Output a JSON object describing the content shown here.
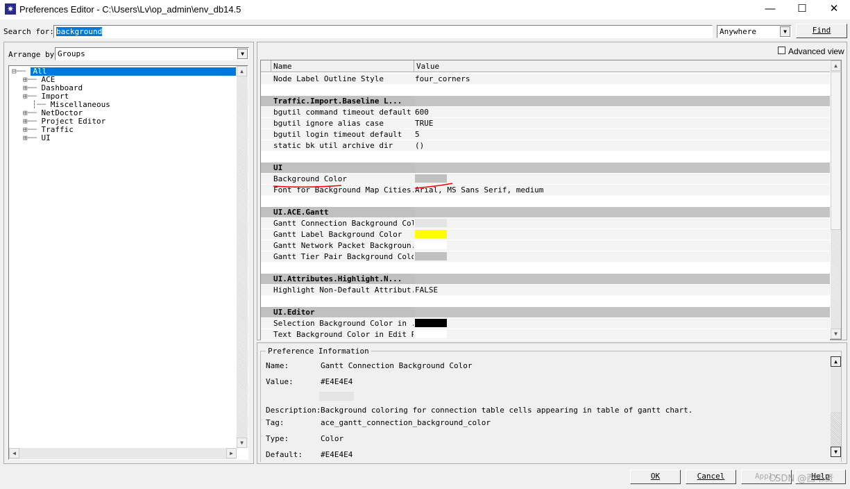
{
  "window": {
    "title": "Preferences Editor - C:\\Users\\Lv\\op_admin\\env_db14.5",
    "minimize": "—",
    "maximize": "☐",
    "close": "✕"
  },
  "search": {
    "label": "Search for:",
    "value": "background",
    "scope": "Anywhere",
    "find_label": "Find"
  },
  "left": {
    "arrange_label": "Arrange by",
    "arrange_value": "Groups",
    "tree": [
      {
        "label": "All",
        "selected": true
      },
      {
        "label": "ACE"
      },
      {
        "label": "Dashboard"
      },
      {
        "label": "Import"
      },
      {
        "label": "Miscellaneous",
        "leaf": true
      },
      {
        "label": "NetDoctor"
      },
      {
        "label": "Project Editor"
      },
      {
        "label": "Traffic"
      },
      {
        "label": "UI"
      }
    ]
  },
  "advanced_view": "Advanced view",
  "table": {
    "headers": [
      "Name",
      "Value"
    ],
    "rows": [
      {
        "name": "Node Label Outline Style",
        "value": "four_corners"
      },
      {
        "blank": true
      },
      {
        "group": "Traffic.Import.Baseline L..."
      },
      {
        "name": "bgutil command timeout default",
        "value": "600"
      },
      {
        "name": "bgutil ignore alias case",
        "value": "TRUE"
      },
      {
        "name": "bgutil login timeout default",
        "value": "5"
      },
      {
        "name": "static bk util archive dir",
        "value": "()"
      },
      {
        "blank": true
      },
      {
        "group": "UI"
      },
      {
        "name": "Background Color",
        "color": "#C0C0C0",
        "marked": true
      },
      {
        "name": "Font for Background Map Cities...",
        "value": "Arial, MS Sans Serif, medium"
      },
      {
        "blank": true
      },
      {
        "group": "UI.ACE.Gantt"
      },
      {
        "name": "Gantt Connection Background Color",
        "color": "#E4E4E4"
      },
      {
        "name": "Gantt Label Background Color",
        "color": "#FFFF00"
      },
      {
        "name": "Gantt Network Packet Backgroun...",
        "color": "#FFFFFF"
      },
      {
        "name": "Gantt Tier Pair Background Color",
        "color": "#C0C0C0"
      },
      {
        "blank": true
      },
      {
        "group": "UI.Attributes.Highlight.N..."
      },
      {
        "name": "Highlight Non-Default Attribut...",
        "value": "FALSE"
      },
      {
        "blank": true
      },
      {
        "group": "UI.Editor"
      },
      {
        "name": "Selection Background Color in ...",
        "color": "#000000"
      },
      {
        "name": "Text Background Color in Edit Pad",
        "color": "#FFFFFF"
      }
    ]
  },
  "info": {
    "title": "Preference Information",
    "name_label": "Name:",
    "name": "Gantt Connection Background Color",
    "value_label": "Value:",
    "value": "#E4E4E4",
    "value_color": "#E4E4E4",
    "desc_label": "Description:",
    "desc": "Background coloring for connection table cells appearing in table of gantt chart.",
    "tag_label": "Tag:",
    "tag": "ace_gantt_connection_background_color",
    "type_label": "Type:",
    "type": "Color",
    "default_label": "Default:",
    "default": "#E4E4E4"
  },
  "buttons": {
    "ok": "OK",
    "cancel": "Cancel",
    "apply": "Apply",
    "help": "Help"
  },
  "watermark": "CSDN @西韦贤"
}
